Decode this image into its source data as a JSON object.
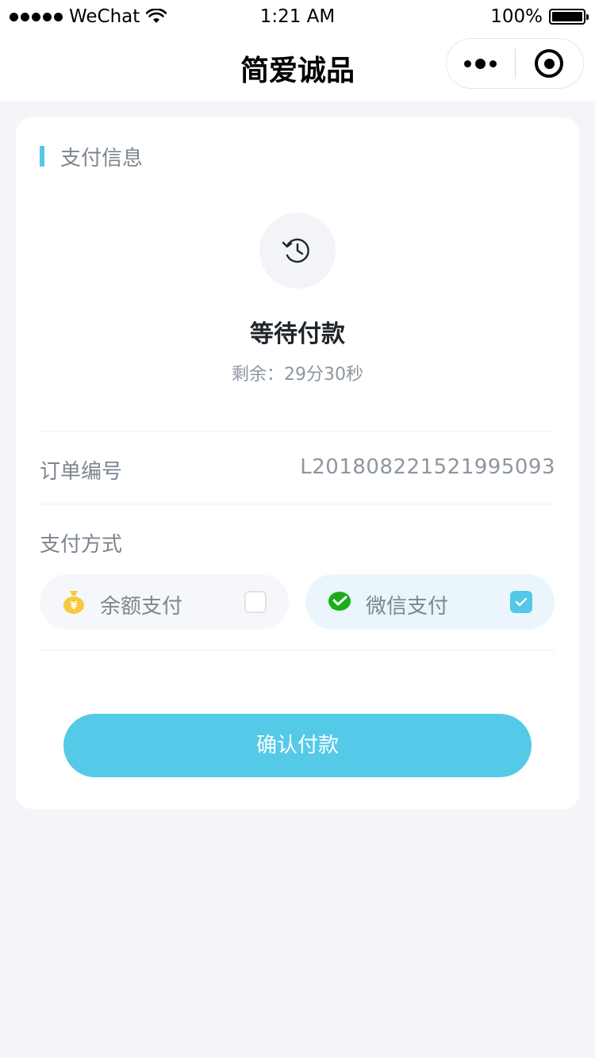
{
  "status_bar": {
    "carrier": "WeChat",
    "time": "1:21 AM",
    "battery": "100%",
    "battery_level": 1.0
  },
  "nav": {
    "title": "简爱诚品",
    "more_icon": "more-dots-icon",
    "close_icon": "target-icon"
  },
  "payment_info": {
    "section_title": "支付信息",
    "status_icon": "history-clock-icon",
    "status": "等待付款",
    "remaining": "剩余：29分30秒",
    "order_label": "订单编号",
    "order_number": "L201808221521995093",
    "method_label": "支付方式",
    "methods": [
      {
        "label": "余额支付",
        "icon": "money-bag-icon",
        "selected": false
      },
      {
        "label": "微信支付",
        "icon": "wechat-icon",
        "selected": true
      }
    ],
    "confirm_button": "确认付款"
  },
  "colors": {
    "accent": "#55c9e8",
    "background": "#f4f5f9",
    "wechat_green": "#1aad19",
    "coin_yellow": "#f8c93c"
  }
}
